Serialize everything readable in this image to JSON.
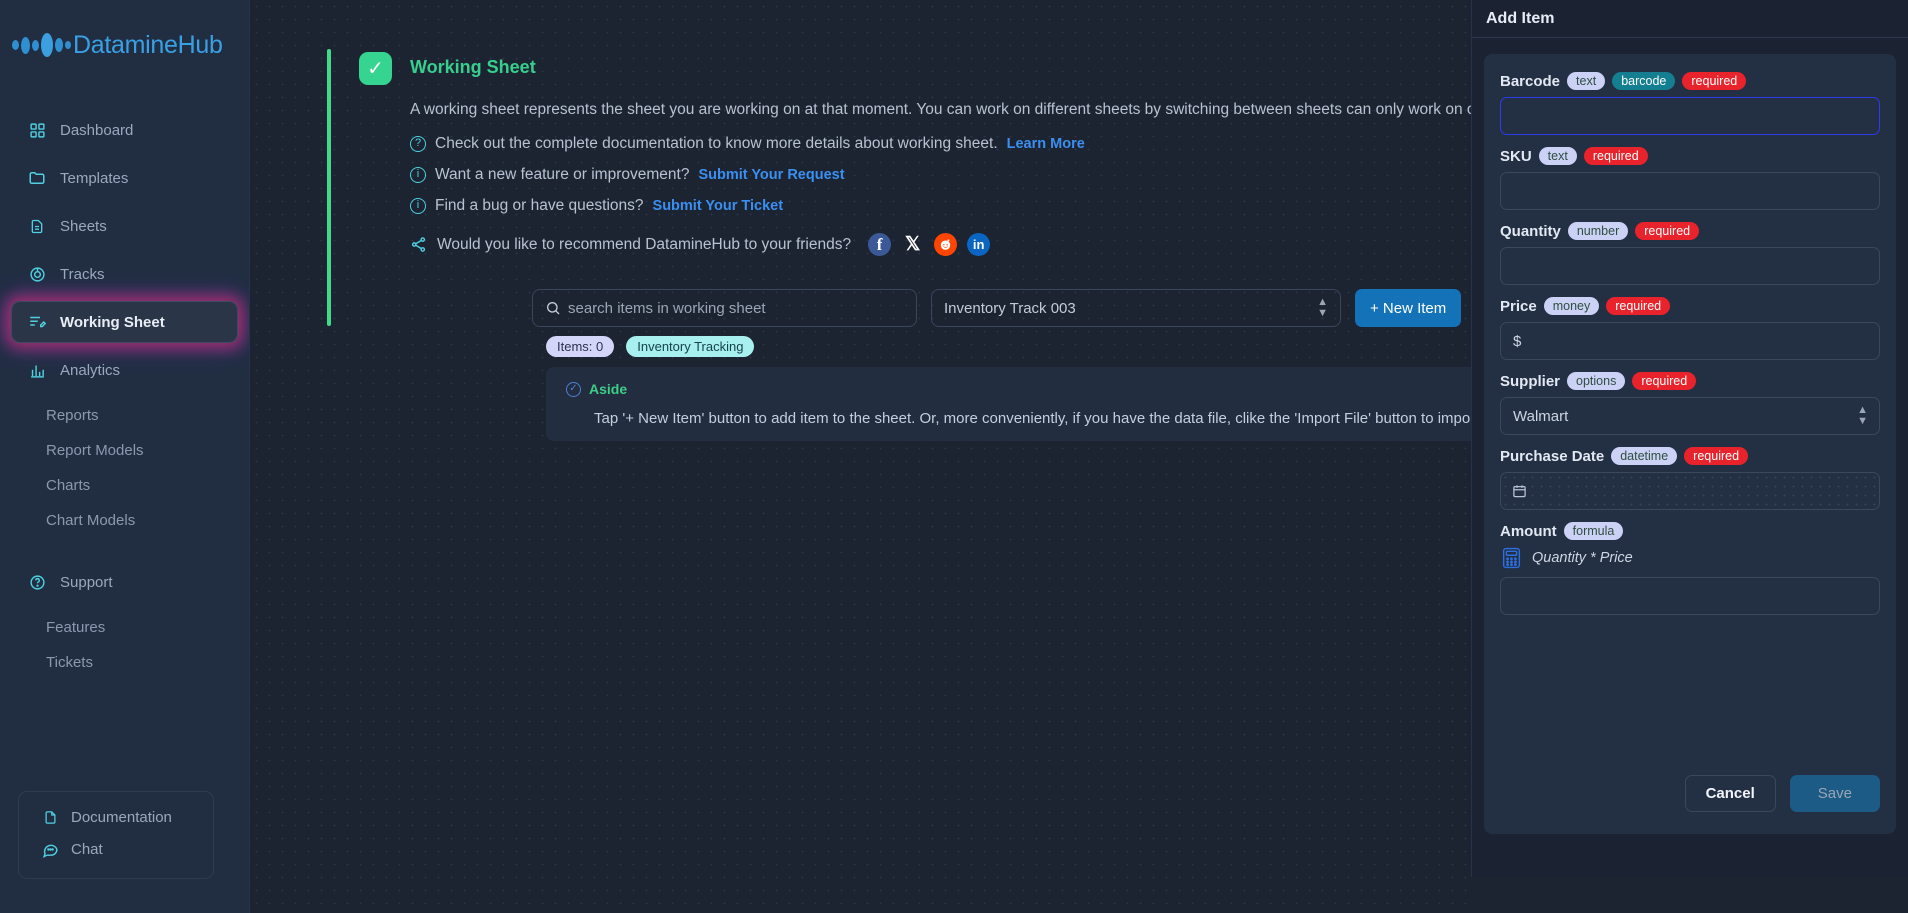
{
  "brand": {
    "name": "DatamineHub"
  },
  "sidebar": {
    "items": [
      {
        "label": "Dashboard",
        "icon": "grid-icon",
        "active": false
      },
      {
        "label": "Templates",
        "icon": "folder-icon",
        "active": false
      },
      {
        "label": "Sheets",
        "icon": "document-icon",
        "active": false
      },
      {
        "label": "Tracks",
        "icon": "target-icon",
        "active": false
      },
      {
        "label": "Working Sheet",
        "icon": "edit-list-icon",
        "active": true
      },
      {
        "label": "Analytics",
        "icon": "bar-chart-icon",
        "active": false
      }
    ],
    "analytics_sub": [
      "Reports",
      "Report Models",
      "Charts",
      "Chart Models"
    ],
    "support": {
      "label": "Support",
      "icon": "question-circle-icon"
    },
    "support_sub": [
      "Features",
      "Tickets"
    ],
    "bottom": [
      {
        "label": "Documentation",
        "icon": "page-icon"
      },
      {
        "label": "Chat",
        "icon": "chat-bubble-icon"
      }
    ]
  },
  "info_card": {
    "title": "Working Sheet",
    "description": "A working sheet represents the sheet you are working on at that moment. You can work on different sheets by switching between sheets can only work on one sheet, even across different mobile devices.",
    "doc_line": "Check out the complete documentation to know more details about working sheet.",
    "doc_link": "Learn More",
    "feature_line": "Want a new feature or improvement?",
    "feature_link": "Submit Your Request",
    "bug_line": "Find a bug or have questions?",
    "bug_link": "Submit Your Ticket",
    "share_text": "Would you like to recommend DatamineHub to your friends?",
    "socials": [
      "facebook-icon",
      "x-icon",
      "reddit-icon",
      "linkedin-icon"
    ]
  },
  "toolbar": {
    "search_placeholder": "search items in working sheet",
    "search_value": "",
    "sheet_selected": "Inventory Track 003",
    "new_item_label": "+ New Item"
  },
  "badges": [
    {
      "label": "Items: 0",
      "style": "lav"
    },
    {
      "label": "Inventory Tracking",
      "style": "cy"
    }
  ],
  "aside": {
    "title": "Aside",
    "text": "Tap '+ New Item' button to add item to the sheet. Or, more conveniently, if you have the data file, clike the 'Import File' button to import all by"
  },
  "panel": {
    "title": "Add Item",
    "fields": [
      {
        "label": "Barcode",
        "type_tag": "text",
        "kind_tag": "barcode",
        "required_tag": "required",
        "control": "input",
        "value": "",
        "focused": true
      },
      {
        "label": "SKU",
        "type_tag": "text",
        "kind_tag": "",
        "required_tag": "required",
        "control": "input",
        "value": ""
      },
      {
        "label": "Quantity",
        "type_tag": "number",
        "kind_tag": "",
        "required_tag": "required",
        "control": "input",
        "value": ""
      },
      {
        "label": "Price",
        "type_tag": "money",
        "kind_tag": "",
        "required_tag": "required",
        "control": "input",
        "value": "$"
      },
      {
        "label": "Supplier",
        "type_tag": "options",
        "kind_tag": "",
        "required_tag": "required",
        "control": "select",
        "value": "Walmart"
      },
      {
        "label": "Purchase Date",
        "type_tag": "datetime",
        "kind_tag": "",
        "required_tag": "required",
        "control": "date",
        "value": ""
      },
      {
        "label": "Amount",
        "type_tag": "formula",
        "kind_tag": "",
        "required_tag": "",
        "control": "formula",
        "formula": "Quantity * Price",
        "value": ""
      }
    ],
    "cancel_label": "Cancel",
    "save_label": "Save"
  },
  "colors": {
    "accent_blue": "#1473b8",
    "accent_green": "#3ddc88",
    "required_red": "#e8232b",
    "brand_blue": "#39a0e5"
  }
}
